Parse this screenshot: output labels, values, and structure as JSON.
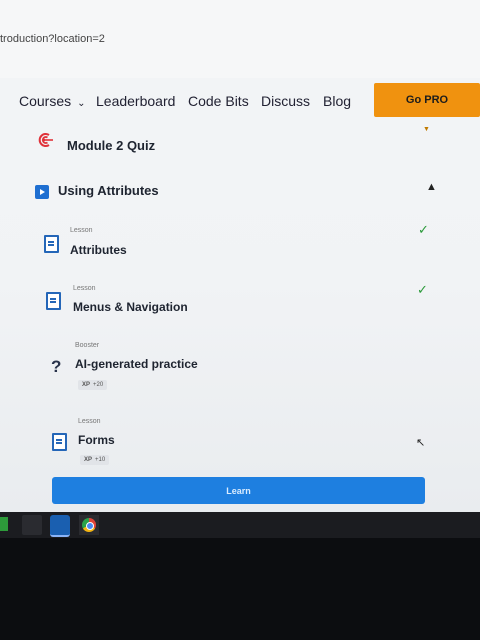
{
  "browser": {
    "url": "troduction?location=2"
  },
  "nav": {
    "items": [
      "Courses",
      "Leaderboard",
      "Code Bits",
      "Discuss",
      "Blog"
    ],
    "cta": "Go PRO"
  },
  "module": {
    "quiz_title": "Module 2 Quiz"
  },
  "section": {
    "title": "Using Attributes"
  },
  "lessons": [
    {
      "kind": "Lesson",
      "title": "Attributes",
      "completed": true
    },
    {
      "kind": "Lesson",
      "title": "Menus & Navigation",
      "completed": true
    },
    {
      "kind": "Booster",
      "title": "AI-generated practice",
      "xp_label": "XP",
      "xp_value": "+20"
    },
    {
      "kind": "Lesson",
      "title": "Forms",
      "xp_label": "XP",
      "xp_value": "+10"
    }
  ],
  "actions": {
    "learn": "Learn"
  },
  "icons": {
    "quiz": "target-icon",
    "section": "play-icon",
    "collapse": "chevron-up-icon",
    "lesson": "document-icon",
    "booster": "question-icon",
    "completed": "check-icon"
  },
  "colors": {
    "accent": "#1e7fe0",
    "pro": "#f0920f",
    "success": "#2b9a3a"
  }
}
